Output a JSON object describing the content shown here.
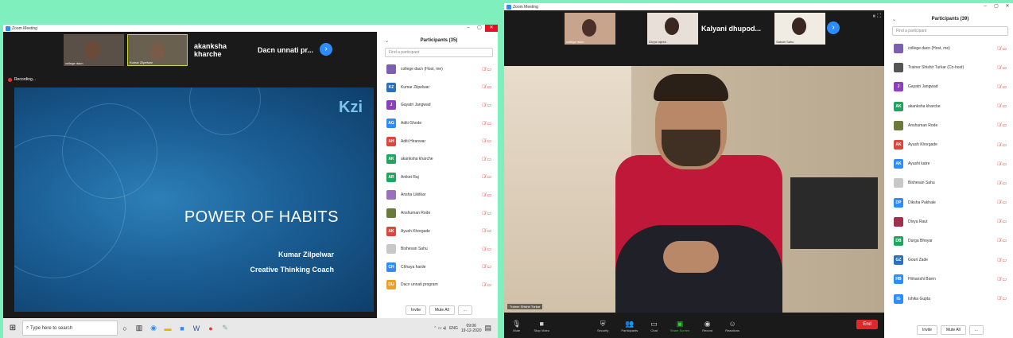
{
  "w1": {
    "title": "Zoom Meeting",
    "thumbs": [
      {
        "name": "college dacn"
      },
      {
        "name": "Kumar Zilpelwar"
      }
    ],
    "text_tiles": [
      "akanksha kharche",
      "Dacn unnati pr..."
    ],
    "recording": "Recording...",
    "slide": {
      "logo": "Kzi",
      "title": "POWER OF HABITS",
      "line1": "Kumar Zilpelwar",
      "line2": "Creative Thinking Coach"
    },
    "panel": {
      "title": "Participants (35)",
      "search": "Find a participant",
      "invite": "Invite",
      "mute_all": "Mute All",
      "more": "...",
      "rows": [
        {
          "initials": "",
          "name": "college dacn (Host, me)",
          "color": "#7b5fb0"
        },
        {
          "initials": "KZ",
          "name": "Kumar Zilpelwar",
          "color": "#2d6fbf"
        },
        {
          "initials": "J",
          "name": "Gayatri Jangwad",
          "color": "#8e3fc0"
        },
        {
          "initials": "AG",
          "name": "Aditi Ghode",
          "color": "#2d8cff"
        },
        {
          "initials": "AH",
          "name": "Aditi Hiranwar",
          "color": "#e0443b"
        },
        {
          "initials": "AK",
          "name": "akanksha kharche",
          "color": "#1ea560"
        },
        {
          "initials": "AR",
          "name": "Aniket Raj",
          "color": "#1ea560"
        },
        {
          "initials": "",
          "name": "Ansha Likitkar",
          "color": "#9b6fc0"
        },
        {
          "initials": "",
          "name": "Anshuman Rode",
          "color": "#6a7a3a"
        },
        {
          "initials": "AK",
          "name": "Ayush Khorgade",
          "color": "#e0443b"
        },
        {
          "initials": "",
          "name": "Bishesan Sahu",
          "color": "#c8c8c8"
        },
        {
          "initials": "CH",
          "name": "Chhaya harde",
          "color": "#2d8cff"
        },
        {
          "initials": "DU",
          "name": "Dacn unnati program",
          "color": "#f0a020"
        }
      ]
    }
  },
  "taskbar": {
    "search": "Type here to search",
    "lang": "ENG",
    "time": "09:06",
    "date": "19-12-2020"
  },
  "w2": {
    "title": "Zoom Meeting",
    "thumbs": [
      {
        "name": "college dacn"
      },
      {
        "name": "Divya rajesh"
      },
      {
        "name": "Sakshi Sahu"
      }
    ],
    "text_tile": "Kalyani dhupod...",
    "speaker": "Trainer Shishir Turkar",
    "panel": {
      "title": "Participants (39)",
      "search": "Find a participant",
      "invite": "Invite",
      "mute_all": "Mute All",
      "more": "...",
      "rows": [
        {
          "initials": "",
          "name": "college dacn (Host, me)",
          "color": "#7b5fb0"
        },
        {
          "initials": "",
          "name": "Trainer Shishir Turkar (Co-host)",
          "color": "#555"
        },
        {
          "initials": "J",
          "name": "Gayatri Jangwad",
          "color": "#8e3fc0"
        },
        {
          "initials": "AK",
          "name": "akanksha kharche",
          "color": "#1ea560"
        },
        {
          "initials": "",
          "name": "Anshuman Rode",
          "color": "#6a7a3a"
        },
        {
          "initials": "AK",
          "name": "Ayush Khorgade",
          "color": "#e0443b"
        },
        {
          "initials": "AK",
          "name": "Ayushi katre",
          "color": "#2d8cff"
        },
        {
          "initials": "",
          "name": "Bishesan Sahu",
          "color": "#c8c8c8"
        },
        {
          "initials": "DP",
          "name": "Diksha Pakhale",
          "color": "#2d8cff"
        },
        {
          "initials": "",
          "name": "Divya Raut",
          "color": "#a03050"
        },
        {
          "initials": "DB",
          "name": "Durga Bhoyar",
          "color": "#1ea560"
        },
        {
          "initials": "GZ",
          "name": "Gouri Zade",
          "color": "#2d6fbf"
        },
        {
          "initials": "HB",
          "name": "Himanshi Bisen",
          "color": "#2d8cff"
        },
        {
          "initials": "IG",
          "name": "Ishika Gupta",
          "color": "#2d8cff"
        }
      ]
    },
    "controls": [
      "Mute",
      "Stop Video",
      "Security",
      "Participants",
      "Chat",
      "Share Screen",
      "Record",
      "Reactions"
    ],
    "end": "End"
  }
}
